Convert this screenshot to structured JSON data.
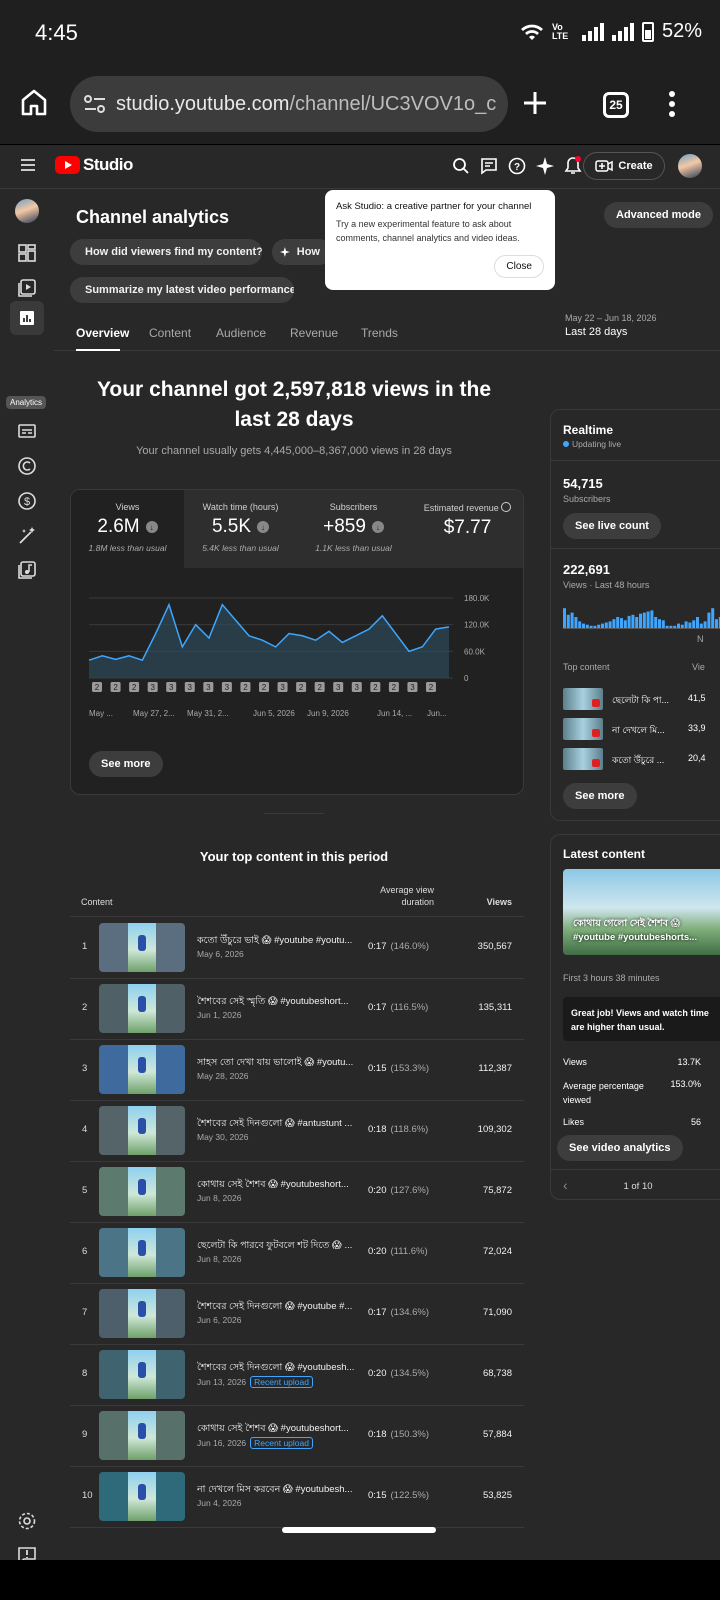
{
  "status": {
    "time": "4:45",
    "battery": "52%",
    "network_label": "Vo LTE"
  },
  "browser": {
    "url_host": "studio.youtube.com",
    "url_path": "/channel/UC3VOV1o_c",
    "tab_count": "25"
  },
  "topbar": {
    "brand": "Studio",
    "create_label": "Create"
  },
  "sidenav": {
    "tooltip": "Analytics"
  },
  "page": {
    "title": "Channel analytics",
    "advanced_mode": "Advanced mode",
    "chips": [
      "How did viewers find my content?",
      "How",
      "Summarize my latest video performance"
    ],
    "tooltip": {
      "title": "Ask Studio: a creative partner for your channel",
      "body": "Try a new experimental feature to ask about comments, channel analytics and video ideas.",
      "close": "Close"
    },
    "tabs": [
      "Overview",
      "Content",
      "Audience",
      "Revenue",
      "Trends"
    ],
    "date_range": "May 22 – Jun 18, 2026",
    "date_range_label": "Last 28 days",
    "headline": "Your channel got 2,597,818 views in the last 28 days",
    "subline": "Your channel usually gets 4,445,000–8,367,000 views in 28 days"
  },
  "metrics": [
    {
      "label": "Views",
      "value": "2.6M",
      "sub": "1.8M less than usual"
    },
    {
      "label": "Watch time (hours)",
      "value": "5.5K",
      "sub": "5.4K less than usual"
    },
    {
      "label": "Subscribers",
      "value": "+859",
      "sub": "1.1K less than usual"
    },
    {
      "label": "Estimated revenue",
      "value": "$7.77",
      "sub": ""
    }
  ],
  "chart_data": {
    "type": "area",
    "x": [
      "May 22",
      "May 23",
      "May 24",
      "May 25",
      "May 26",
      "May 27",
      "May 28",
      "May 29",
      "May 30",
      "May 31",
      "Jun 1",
      "Jun 2",
      "Jun 3",
      "Jun 4",
      "Jun 5",
      "Jun 6",
      "Jun 7",
      "Jun 8",
      "Jun 9",
      "Jun 10",
      "Jun 11",
      "Jun 12",
      "Jun 13",
      "Jun 14",
      "Jun 15",
      "Jun 16",
      "Jun 17",
      "Jun 18"
    ],
    "x_tick_labels": [
      "May ...",
      "May 27, 2...",
      "May 31, 2...",
      "Jun 5, 2026",
      "Jun 9, 2026",
      "Jun 14, ...",
      "Jun..."
    ],
    "series": [
      {
        "values": [
          40000,
          50000,
          42000,
          50000,
          40000,
          100000,
          165000,
          70000,
          120000,
          90000,
          165000,
          130000,
          95000,
          85000,
          70000,
          100000,
          95000,
          85000,
          105000,
          80000,
          95000,
          110000,
          140000,
          100000,
          60000,
          70000,
          110000,
          115000
        ]
      }
    ],
    "y_ticks": [
      "180.0K",
      "120.0K",
      "60.0K",
      "0"
    ],
    "ylim": [
      0,
      180000
    ],
    "markers": [
      "2",
      "2",
      "2",
      "3",
      "3",
      "3",
      "3",
      "3",
      "2",
      "2",
      "3",
      "2",
      "2",
      "3",
      "3",
      "2",
      "2",
      "3",
      "2"
    ],
    "grid": true
  },
  "see_more": "See more",
  "top_content": {
    "title": "Your top content in this period",
    "col_content": "Content",
    "col_avd": "Average view duration",
    "col_views": "Views",
    "rows": [
      {
        "rank": "1",
        "title": "কতো উঁচুরে ভাই 😱 #youtube #youtu...",
        "date": "May 6, 2026",
        "badge": "",
        "dur": "0:17",
        "pct": "(146.0%)",
        "views": "350,567"
      },
      {
        "rank": "2",
        "title": "শৈশবের সেই স্মৃতি 😱 #youtubeshort...",
        "date": "Jun 1, 2026",
        "badge": "",
        "dur": "0:17",
        "pct": "(116.5%)",
        "views": "135,311"
      },
      {
        "rank": "3",
        "title": "সাহস তো দেখা যায় ভালোই 😱 #youtu...",
        "date": "May 28, 2026",
        "badge": "",
        "dur": "0:15",
        "pct": "(153.3%)",
        "views": "112,387"
      },
      {
        "rank": "4",
        "title": "শৈশবের সেই দিনগুলো 😱 #antustunt ...",
        "date": "May 30, 2026",
        "badge": "",
        "dur": "0:18",
        "pct": "(118.6%)",
        "views": "109,302"
      },
      {
        "rank": "5",
        "title": "কোথায় সেই শৈশব 😱 #youtubeshort...",
        "date": "Jun 8, 2026",
        "badge": "",
        "dur": "0:20",
        "pct": "(127.6%)",
        "views": "75,872"
      },
      {
        "rank": "6",
        "title": "ছেলেটা কি পারবে ফুটবলে শট দিতে 😱 ...",
        "date": "Jun 8, 2026",
        "badge": "",
        "dur": "0:20",
        "pct": "(111.6%)",
        "views": "72,024"
      },
      {
        "rank": "7",
        "title": "শৈশবের সেই দিনগুলো 😱 #youtube #...",
        "date": "Jun 6, 2026",
        "badge": "",
        "dur": "0:17",
        "pct": "(134.6%)",
        "views": "71,090"
      },
      {
        "rank": "8",
        "title": "শৈশবের সেই দিনগুলো 😱 #youtubesh...",
        "date": "Jun 13, 2026",
        "badge": "Recent upload",
        "dur": "0:20",
        "pct": "(134.5%)",
        "views": "68,738"
      },
      {
        "rank": "9",
        "title": "কোথায় সেই শৈশব 😱 #youtubeshort...",
        "date": "Jun 16, 2026",
        "badge": "Recent upload",
        "dur": "0:18",
        "pct": "(150.3%)",
        "views": "57,884"
      },
      {
        "rank": "10",
        "title": "না দেখলে মিস করবেন 😱 #youtubesh...",
        "date": "Jun 4, 2026",
        "badge": "",
        "dur": "0:15",
        "pct": "(122.5%)",
        "views": "53,825"
      }
    ]
  },
  "realtime": {
    "title": "Realtime",
    "status": "Updating live",
    "subs_value": "54,715",
    "subs_label": "Subscribers",
    "live_btn": "See live count",
    "views_value": "222,691",
    "views_label": "Views · Last 48 hours",
    "axis_letter": "N",
    "top_content_label": "Top content",
    "views_col": "Vie",
    "bars": [
      0.9,
      0.6,
      0.7,
      0.5,
      0.3,
      0.2,
      0.15,
      0.1,
      0.1,
      0.15,
      0.2,
      0.25,
      0.3,
      0.4,
      0.5,
      0.45,
      0.35,
      0.55,
      0.6,
      0.5,
      0.65,
      0.7,
      0.75,
      0.8,
      0.5,
      0.4,
      0.35,
      0.1,
      0.1,
      0.1,
      0.2,
      0.15,
      0.3,
      0.25,
      0.35,
      0.5,
      0.2,
      0.3,
      0.7,
      0.9,
      0.4,
      0.5,
      0.6
    ],
    "items": [
      {
        "title": "ছেলেটা কি পা...",
        "views": "41,5"
      },
      {
        "title": "না দেখলে মি...",
        "views": "33,9"
      },
      {
        "title": "কতো উঁচুরে ...",
        "views": "20,4"
      }
    ]
  },
  "latest": {
    "title": "Latest content",
    "thumb_caption": "কোথায় গেলো সেই শৈশব 😱 #youtube #youtubeshorts...",
    "first_time": "First 3 hours 38 minutes",
    "callout": "Great job! Views and watch time are higher than usual.",
    "stats": [
      {
        "label": "Views",
        "value": "13.7K"
      },
      {
        "label": "Average percentage viewed",
        "value": "153.0%"
      },
      {
        "label": "Likes",
        "value": "56"
      }
    ],
    "btn": "See video analytics",
    "pager": "1 of 10"
  }
}
